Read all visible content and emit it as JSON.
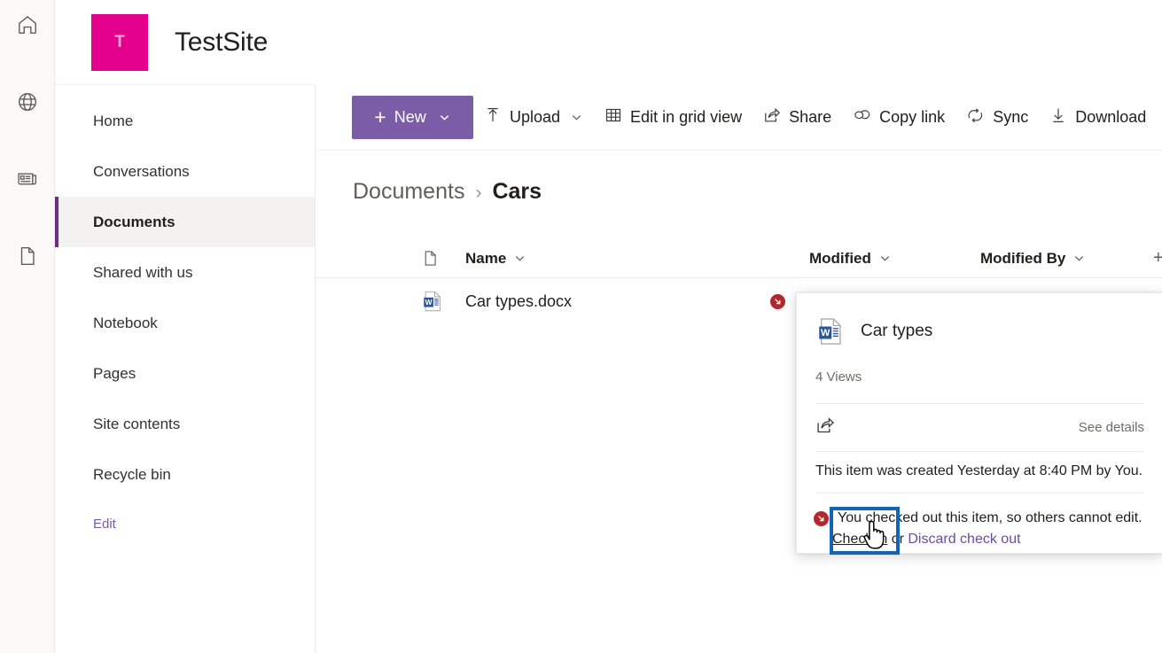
{
  "rail": {
    "items": [
      {
        "name": "home-icon",
        "label": "Home"
      },
      {
        "name": "globe-icon",
        "label": "SharePoint"
      },
      {
        "name": "news-icon",
        "label": "News"
      },
      {
        "name": "document-icon",
        "label": "Documents"
      }
    ]
  },
  "site": {
    "logo_letter": "T",
    "logo_color": "#e3008c",
    "title": "TestSite"
  },
  "sidebar": {
    "items": [
      {
        "label": "Home",
        "selected": false
      },
      {
        "label": "Conversations",
        "selected": false
      },
      {
        "label": "Documents",
        "selected": true
      },
      {
        "label": "Shared with us",
        "selected": false
      },
      {
        "label": "Notebook",
        "selected": false
      },
      {
        "label": "Pages",
        "selected": false
      },
      {
        "label": "Site contents",
        "selected": false
      },
      {
        "label": "Recycle bin",
        "selected": false
      }
    ],
    "edit_label": "Edit",
    "accent_color": "#6b2d88"
  },
  "toolbar": {
    "new_label": "New",
    "new_color": "#7b5ca7",
    "upload_label": "Upload",
    "edit_grid_label": "Edit in grid view",
    "share_label": "Share",
    "copy_link_label": "Copy link",
    "sync_label": "Sync",
    "download_label": "Download"
  },
  "breadcrumb": {
    "parent": "Documents",
    "separator": "›",
    "current": "Cars"
  },
  "table": {
    "columns": {
      "name": "Name",
      "modified": "Modified",
      "modified_by": "Modified By",
      "add": "+"
    },
    "rows": [
      {
        "name": "Car types.docx",
        "file_type": "docx",
        "status": "checked-out",
        "modified": "",
        "modified_by": ""
      }
    ]
  },
  "callout": {
    "file_title": "Car types",
    "views": "4 Views",
    "see_details": "See details",
    "created_text": "This item was created Yesterday at 8:40 PM by You.",
    "checkout_message": "You checked out this item, so others cannot edit.",
    "checkin_link": "Check in",
    "or_text": " or ",
    "discard_link": "Discard check out",
    "discard_color": "#6b4d9e"
  },
  "annotation": {
    "highlight_color": "#1464b4",
    "highlight_target": "Check in"
  }
}
